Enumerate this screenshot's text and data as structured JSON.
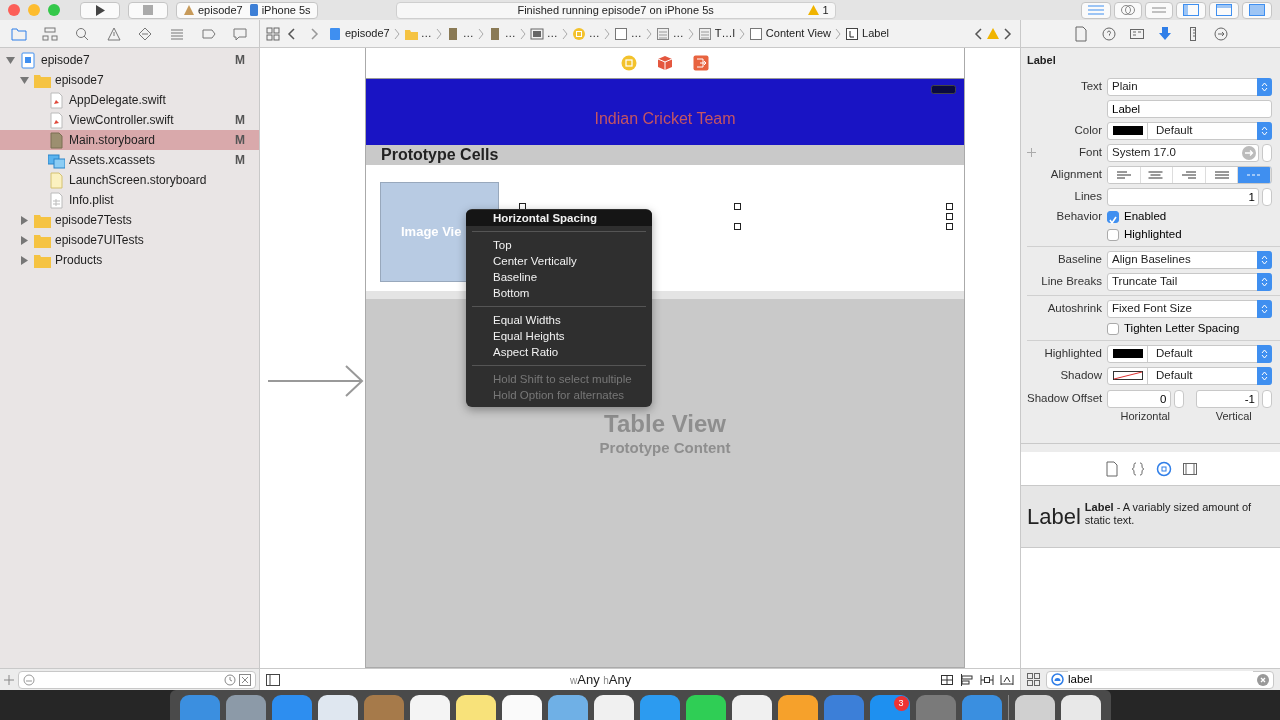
{
  "titlebar": {
    "scheme": "episode7",
    "device": "iPhone 5s",
    "status": "Finished running episode7 on iPhone 5s",
    "warnings": "1"
  },
  "navigator_tabs": [
    {
      "kind": "folder",
      "selected": true
    },
    {
      "kind": "hierarchy",
      "selected": false
    },
    {
      "kind": "search",
      "selected": false
    },
    {
      "kind": "warning",
      "selected": false
    },
    {
      "kind": "diamond",
      "selected": false
    },
    {
      "kind": "list",
      "selected": false
    },
    {
      "kind": "tag",
      "selected": false
    },
    {
      "kind": "bubble",
      "selected": false
    }
  ],
  "jump_bar": [
    {
      "kind": "project",
      "label": "episode7"
    },
    {
      "kind": "folder",
      "label": "…"
    },
    {
      "kind": "file",
      "label": "…"
    },
    {
      "kind": "file",
      "label": "…"
    },
    {
      "kind": "scene",
      "label": "…"
    },
    {
      "kind": "controller",
      "label": "…"
    },
    {
      "kind": "view",
      "label": "…"
    },
    {
      "kind": "table",
      "label": "…"
    },
    {
      "kind": "table",
      "label": "T…l"
    },
    {
      "kind": "view",
      "label": "Content View"
    },
    {
      "kind": "label",
      "label": "Label"
    }
  ],
  "navigator": {
    "tree": [
      {
        "name": "episode7",
        "kind": "project",
        "status": "M",
        "expanded": true,
        "selected": false,
        "children": [
          {
            "name": "episode7",
            "kind": "folder",
            "expanded": true,
            "selected": false,
            "children": [
              {
                "name": "AppDelegate.swift",
                "kind": "swift",
                "selected": false
              },
              {
                "name": "ViewController.swift",
                "kind": "swift",
                "status": "M",
                "selected": false
              },
              {
                "name": "Main.storyboard",
                "kind": "storyboard",
                "status": "M",
                "selected": true
              },
              {
                "name": "Assets.xcassets",
                "kind": "assets",
                "status": "M",
                "selected": false
              },
              {
                "name": "LaunchScreen.storyboard",
                "kind": "storyboard_light",
                "selected": false
              },
              {
                "name": "Info.plist",
                "kind": "plist",
                "selected": false
              }
            ]
          },
          {
            "name": "episode7Tests",
            "kind": "folder",
            "expanded": false,
            "selected": false
          },
          {
            "name": "episode7UITests",
            "kind": "folder",
            "expanded": false,
            "selected": false
          },
          {
            "name": "Products",
            "kind": "folder",
            "expanded": false,
            "selected": false
          }
        ]
      }
    ]
  },
  "canvas": {
    "nav_title": "Indian Cricket Team",
    "section_header": "Prototype Cells",
    "image_view": "Image Vie",
    "table_title": "Table View",
    "table_subtitle": "Prototype Content",
    "context_menu": [
      {
        "kind": "item",
        "label": "Horizontal Spacing",
        "highlighted": true
      },
      {
        "kind": "separator"
      },
      {
        "kind": "item",
        "label": "Top",
        "highlighted": false
      },
      {
        "kind": "item",
        "label": "Center Vertically",
        "highlighted": false
      },
      {
        "kind": "item",
        "label": "Baseline",
        "highlighted": false
      },
      {
        "kind": "item",
        "label": "Bottom",
        "highlighted": false
      },
      {
        "kind": "separator"
      },
      {
        "kind": "item",
        "label": "Equal Widths",
        "highlighted": false
      },
      {
        "kind": "item",
        "label": "Equal Heights",
        "highlighted": false
      },
      {
        "kind": "item",
        "label": "Aspect Ratio",
        "highlighted": false
      },
      {
        "kind": "separator"
      },
      {
        "kind": "hint",
        "label": "Hold Shift to select multiple"
      },
      {
        "kind": "hint",
        "label": "Hold Option for alternates"
      }
    ],
    "size_class": {
      "w_prefix": "w",
      "w_value": "Any",
      "h_prefix": "h",
      "h_value": "Any"
    }
  },
  "inspector_tabs": [
    {
      "kind": "file",
      "selected": false
    },
    {
      "kind": "help",
      "selected": false
    },
    {
      "kind": "identity",
      "selected": false
    },
    {
      "kind": "attributes",
      "selected": true
    },
    {
      "kind": "size",
      "selected": false
    },
    {
      "kind": "connections",
      "selected": false
    }
  ],
  "inspector": {
    "title": "Label",
    "rows": [
      {
        "kind": "select",
        "label": "Text",
        "value": "Plain"
      },
      {
        "kind": "text",
        "value": "Label"
      },
      {
        "kind": "color_select",
        "label": "Color",
        "color": "#000000",
        "value": "Default"
      },
      {
        "kind": "font",
        "label": "Font",
        "value": "System 17.0"
      },
      {
        "kind": "segments",
        "label": "Alignment",
        "segments": [
          {
            "kind": "left",
            "selected": false
          },
          {
            "kind": "center",
            "selected": false
          },
          {
            "kind": "right",
            "selected": false
          },
          {
            "kind": "justified",
            "selected": false
          },
          {
            "kind": "natural",
            "selected": true
          }
        ]
      },
      {
        "kind": "stepper",
        "label": "Lines",
        "value": "1"
      },
      {
        "kind": "check",
        "label": "Behavior",
        "text": "Enabled",
        "checked": true
      },
      {
        "kind": "check",
        "text": "Highlighted",
        "checked": false
      },
      {
        "kind": "divider"
      },
      {
        "kind": "select",
        "label": "Baseline",
        "value": "Align Baselines"
      },
      {
        "kind": "select",
        "label": "Line Breaks",
        "value": "Truncate Tail"
      },
      {
        "kind": "divider"
      },
      {
        "kind": "select",
        "label": "Autoshrink",
        "value": "Fixed Font Size"
      },
      {
        "kind": "check",
        "text": "Tighten Letter Spacing",
        "checked": false
      },
      {
        "kind": "divider"
      },
      {
        "kind": "color_select",
        "label": "Highlighted",
        "color": "#000000",
        "value": "Default"
      },
      {
        "kind": "shadow_select",
        "label": "Shadow",
        "value": "Default"
      },
      {
        "kind": "offset",
        "label": "Shadow Offset",
        "h_value": "0",
        "h_label": "Horizontal",
        "v_value": "-1",
        "v_label": "Vertical"
      }
    ]
  },
  "library": {
    "tabs": [
      {
        "kind": "file",
        "selected": false
      },
      {
        "kind": "code",
        "selected": false
      },
      {
        "kind": "object",
        "selected": true
      },
      {
        "kind": "media",
        "selected": false
      }
    ],
    "items": [
      {
        "title": "Label",
        "description": "**Label** - A variably sized amount of static text."
      }
    ],
    "search": "label"
  },
  "dock": {
    "badge": "3"
  }
}
